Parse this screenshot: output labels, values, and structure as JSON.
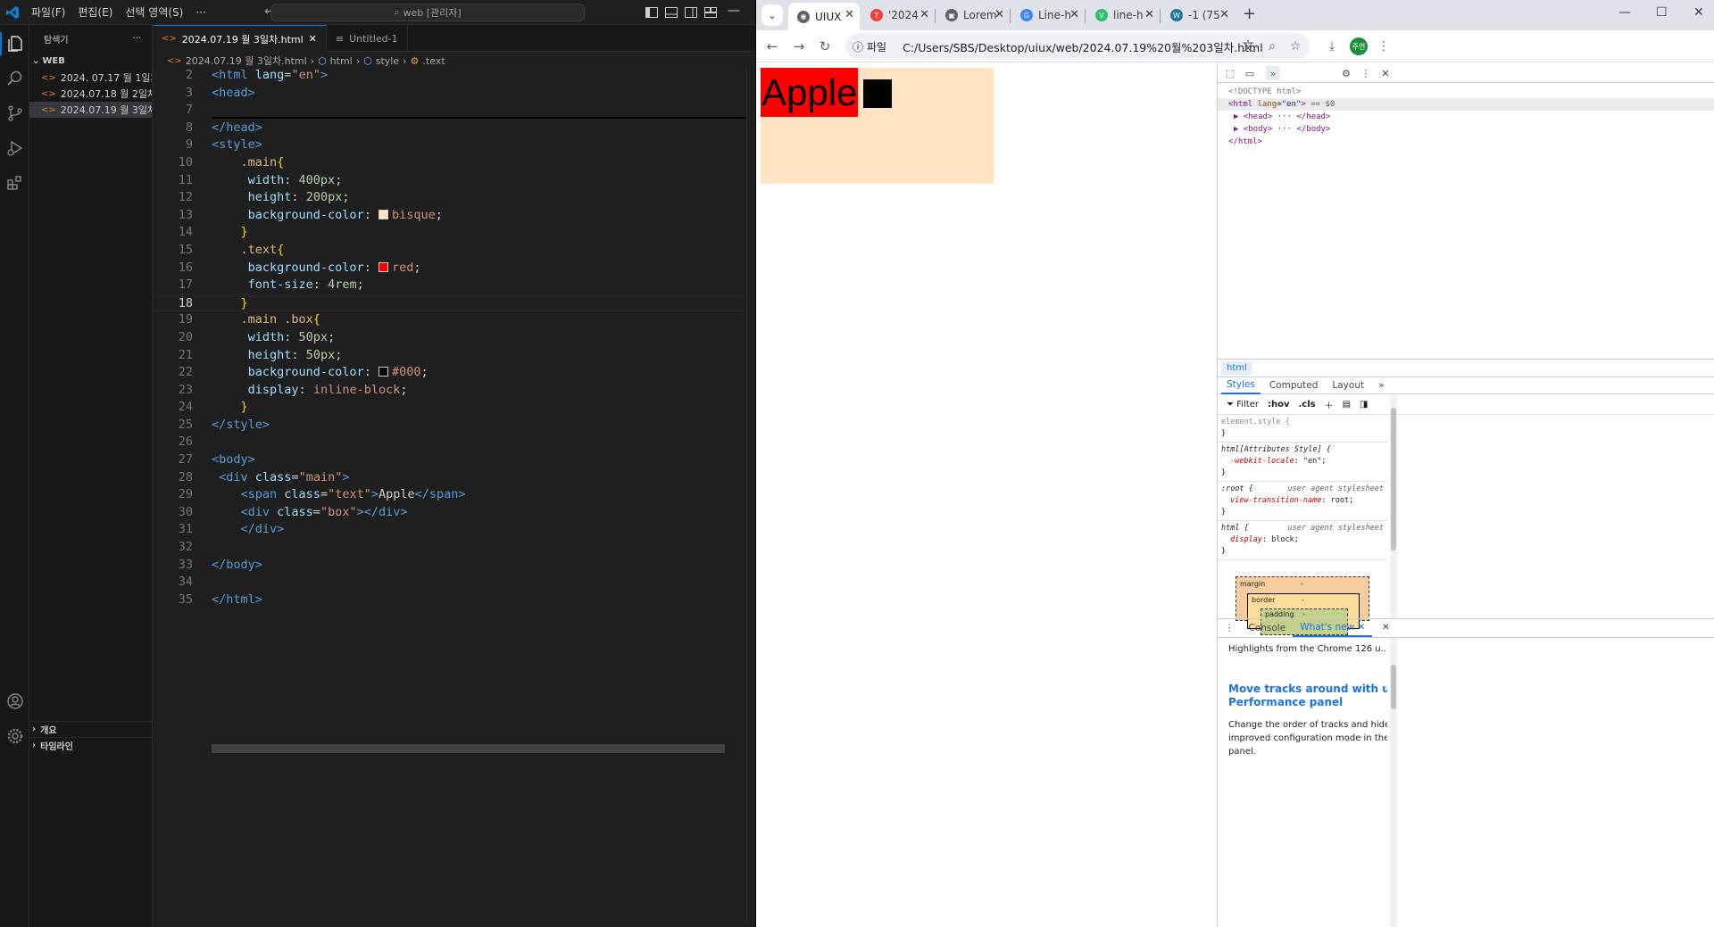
{
  "vscode": {
    "menu": [
      "파일(F)",
      "편집(E)",
      "선택 영역(S)",
      "···"
    ],
    "search_label": "web [관리자]",
    "sidebar": {
      "title": "탐색기",
      "more": "···",
      "section": "WEB",
      "files": [
        "2024. 07.17 월 1일차....",
        "2024.07.18 월 2일차.h...",
        "2024.07.19 월 3일차.h..."
      ],
      "bottom_sections": [
        "개요",
        "타임라인"
      ]
    },
    "tabs": [
      {
        "label": "2024.07.19 월 3일차.html",
        "close": "✕"
      },
      {
        "label": "Untitled-1"
      }
    ],
    "breadcrumb": [
      "2024.07.19 월 3일차.html",
      "html",
      "style",
      ".text"
    ],
    "lines": [
      {
        "n": "2",
        "tokens": [
          [
            "t-tag",
            "<html "
          ],
          [
            "t-attr",
            "lang"
          ],
          [
            "t-text",
            "="
          ],
          [
            "t-str",
            "\"en\""
          ],
          [
            "t-tag",
            ">"
          ]
        ]
      },
      {
        "n": "3",
        "tokens": [
          [
            "t-tag",
            "<head>"
          ]
        ]
      },
      {
        "n": "7",
        "tokens": []
      },
      {
        "n": "8",
        "tokens": [
          [
            "t-tag",
            "</head>"
          ]
        ]
      },
      {
        "n": "9",
        "tokens": [
          [
            "t-tag",
            "<style>"
          ]
        ]
      },
      {
        "n": "10",
        "tokens": [
          [
            "t-text",
            "    "
          ],
          [
            "t-sel",
            ".main"
          ],
          [
            "t-brace",
            "{"
          ]
        ]
      },
      {
        "n": "11",
        "tokens": [
          [
            "t-text",
            "     "
          ],
          [
            "t-prop",
            "width"
          ],
          [
            "t-text",
            ": "
          ],
          [
            "t-num",
            "400px"
          ],
          [
            "t-text",
            ";"
          ]
        ]
      },
      {
        "n": "12",
        "tokens": [
          [
            "t-text",
            "     "
          ],
          [
            "t-prop",
            "height"
          ],
          [
            "t-text",
            ": "
          ],
          [
            "t-num",
            "200px"
          ],
          [
            "t-text",
            ";"
          ]
        ]
      },
      {
        "n": "13",
        "tokens": [
          [
            "t-text",
            "     "
          ],
          [
            "t-prop",
            "background-color"
          ],
          [
            "t-text",
            ": "
          ],
          [
            "swatch",
            "bisque"
          ],
          [
            "t-val",
            "bisque"
          ],
          [
            "t-text",
            ";"
          ]
        ]
      },
      {
        "n": "14",
        "tokens": [
          [
            "t-text",
            "    "
          ],
          [
            "t-brace",
            "}"
          ]
        ]
      },
      {
        "n": "15",
        "tokens": [
          [
            "t-text",
            "    "
          ],
          [
            "t-sel",
            ".text"
          ],
          [
            "t-brace",
            "{"
          ]
        ]
      },
      {
        "n": "16",
        "tokens": [
          [
            "t-text",
            "     "
          ],
          [
            "t-prop",
            "background-color"
          ],
          [
            "t-text",
            ": "
          ],
          [
            "swatch",
            "red"
          ],
          [
            "t-val",
            "red"
          ],
          [
            "t-text",
            ";"
          ]
        ]
      },
      {
        "n": "17",
        "tokens": [
          [
            "t-text",
            "     "
          ],
          [
            "t-prop",
            "font-size"
          ],
          [
            "t-text",
            ": "
          ],
          [
            "t-num",
            "4rem"
          ],
          [
            "t-text",
            ";"
          ]
        ]
      },
      {
        "n": "18",
        "current": true,
        "tokens": [
          [
            "t-text",
            "    "
          ],
          [
            "t-brace",
            "}"
          ]
        ]
      },
      {
        "n": "19",
        "tokens": [
          [
            "t-text",
            "    "
          ],
          [
            "t-sel",
            ".main .box"
          ],
          [
            "t-brace",
            "{"
          ]
        ]
      },
      {
        "n": "20",
        "tokens": [
          [
            "t-text",
            "     "
          ],
          [
            "t-prop",
            "width"
          ],
          [
            "t-text",
            ": "
          ],
          [
            "t-num",
            "50px"
          ],
          [
            "t-text",
            ";"
          ]
        ]
      },
      {
        "n": "21",
        "tokens": [
          [
            "t-text",
            "     "
          ],
          [
            "t-prop",
            "height"
          ],
          [
            "t-text",
            ": "
          ],
          [
            "t-num",
            "50px"
          ],
          [
            "t-text",
            ";"
          ]
        ]
      },
      {
        "n": "22",
        "tokens": [
          [
            "t-text",
            "     "
          ],
          [
            "t-prop",
            "background-color"
          ],
          [
            "t-text",
            ": "
          ],
          [
            "swatch",
            "#000"
          ],
          [
            "t-val",
            "#000"
          ],
          [
            "t-text",
            ";"
          ]
        ]
      },
      {
        "n": "23",
        "tokens": [
          [
            "t-text",
            "     "
          ],
          [
            "t-prop",
            "display"
          ],
          [
            "t-text",
            ": "
          ],
          [
            "t-val",
            "inline-block"
          ],
          [
            "t-text",
            ";"
          ]
        ]
      },
      {
        "n": "24",
        "tokens": [
          [
            "t-text",
            "    "
          ],
          [
            "t-brace",
            "}"
          ]
        ]
      },
      {
        "n": "25",
        "tokens": [
          [
            "t-tag",
            "</style>"
          ]
        ]
      },
      {
        "n": "26",
        "tokens": []
      },
      {
        "n": "27",
        "tokens": [
          [
            "t-tag",
            "<body>"
          ]
        ]
      },
      {
        "n": "28",
        "tokens": [
          [
            "t-text",
            " "
          ],
          [
            "t-tag",
            "<div "
          ],
          [
            "t-attr",
            "class"
          ],
          [
            "t-text",
            "="
          ],
          [
            "t-str",
            "\"main\""
          ],
          [
            "t-tag",
            ">"
          ]
        ]
      },
      {
        "n": "29",
        "tokens": [
          [
            "t-text",
            "    "
          ],
          [
            "t-tag",
            "<span "
          ],
          [
            "t-attr",
            "class"
          ],
          [
            "t-text",
            "="
          ],
          [
            "t-str",
            "\"text\""
          ],
          [
            "t-tag",
            ">"
          ],
          [
            "t-text",
            "Apple"
          ],
          [
            "t-tag",
            "</span>"
          ]
        ]
      },
      {
        "n": "30",
        "tokens": [
          [
            "t-text",
            "    "
          ],
          [
            "t-tag",
            "<div "
          ],
          [
            "t-attr",
            "class"
          ],
          [
            "t-text",
            "="
          ],
          [
            "t-str",
            "\"box\""
          ],
          [
            "t-tag",
            "></div>"
          ]
        ]
      },
      {
        "n": "31",
        "tokens": [
          [
            "t-text",
            "    "
          ],
          [
            "t-tag",
            "</div>"
          ]
        ]
      },
      {
        "n": "32",
        "tokens": []
      },
      {
        "n": "33",
        "tokens": [
          [
            "t-tag",
            "</body>"
          ]
        ]
      },
      {
        "n": "34",
        "tokens": []
      },
      {
        "n": "35",
        "tokens": [
          [
            "t-tag",
            "</html>"
          ]
        ]
      }
    ]
  },
  "chrome": {
    "tabs": [
      {
        "label": "UIUX",
        "fav_color": "#5f6368",
        "fav_glyph": "◉"
      },
      {
        "label": "'2024",
        "fav_color": "#e8453c",
        "fav_glyph": "T"
      },
      {
        "label": "Lorem",
        "fav_color": "#5f6368",
        "fav_glyph": "▣"
      },
      {
        "label": "Line-h",
        "fav_color": "#4285f4",
        "fav_glyph": "G"
      },
      {
        "label": "line-h",
        "fav_color": "#2fbf71",
        "fav_glyph": "V"
      },
      {
        "label": "-1 (75",
        "fav_color": "#21759b",
        "fav_glyph": "W"
      }
    ],
    "tab_close": "✕",
    "new_tab": "+",
    "omnibox_chip": "파일",
    "url": "C:/Users/SBS/Desktop/uiux/web/2024.07.19%20월%203일차.html",
    "profile_initials": "주연",
    "page": {
      "text": "Apple"
    },
    "devtools": {
      "dom": {
        "doctype": "<!DOCTYPE html>",
        "html_open_tag": "<html",
        "html_attr": "lang",
        "html_attr_val": "\"en\"",
        "html_close_bracket": ">",
        "eq_dollar": "== $0",
        "head": "▶ <head> ··· </head>",
        "body": "▶ <body> ··· </body>",
        "html_close": "</html>"
      },
      "crumb": "html",
      "subtabs": [
        "Styles",
        "Computed",
        "Layout",
        "»"
      ],
      "filter": "Filter",
      "hov": ":hov",
      "cls": ".cls",
      "rules": [
        {
          "selector": "element.style {",
          "source": "",
          "props": [],
          "close": "}"
        },
        {
          "selector": "html[Attributes Style] {",
          "source": "",
          "props": [
            [
              "-webkit-locale",
              "\"en\""
            ]
          ],
          "close": "}"
        },
        {
          "selector": ":root {",
          "source": "user agent stylesheet",
          "props": [
            [
              "view-transition-name",
              "root"
            ]
          ],
          "close": "}"
        },
        {
          "selector": "html {",
          "source": "user agent stylesheet",
          "props": [
            [
              "display",
              "block"
            ]
          ],
          "close": "}"
        }
      ],
      "boxmodel": {
        "margin": "margin",
        "border": "border",
        "padding": "padding",
        "dash": "-"
      },
      "drawer_tabs": [
        "Console",
        "What's new"
      ],
      "whats_new": {
        "headline": "Highlights from the Chrome 126 u...",
        "title_line1": "Move tracks around with updat",
        "title_line2": "Performance panel",
        "body_line1": "Change the order of tracks and hide th",
        "body_line2": "improved configuration mode in the Pe",
        "body_line3": "panel."
      }
    }
  }
}
